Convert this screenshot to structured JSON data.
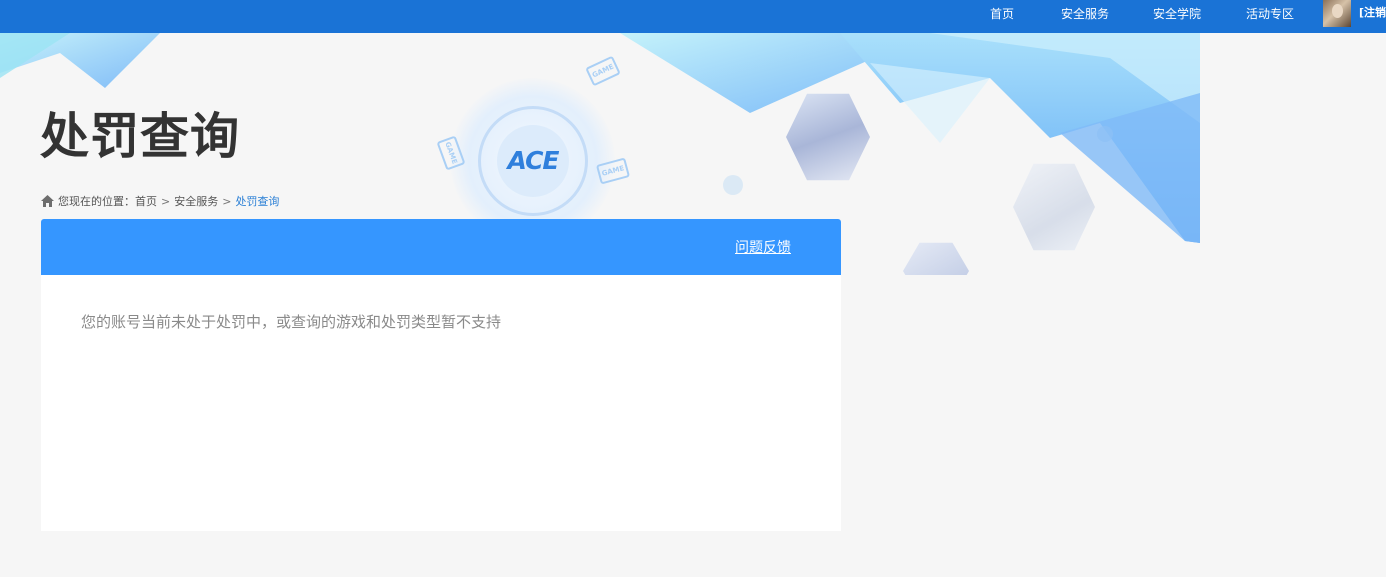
{
  "nav": {
    "items": [
      {
        "label": "首页"
      },
      {
        "label": "安全服务"
      },
      {
        "label": "安全学院"
      },
      {
        "label": "活动专区"
      }
    ],
    "logout_label": "[注销]"
  },
  "banner": {
    "emblem_text": "ACE",
    "game_tag": "GAME"
  },
  "page": {
    "title": "处罚查询"
  },
  "breadcrumb": {
    "prefix": "您现在的位置：",
    "items": [
      {
        "label": "首页"
      },
      {
        "label": "安全服务"
      },
      {
        "label": "处罚查询"
      }
    ],
    "separator": ">"
  },
  "card": {
    "feedback_label": "问题反馈",
    "message": "您的账号当前未处于处罚中，或查询的游戏和处罚类型暂不支持"
  },
  "colors": {
    "topbar": "#1a73d6",
    "card_header": "#3596ff",
    "breadcrumb_current": "#2a7fd5"
  }
}
